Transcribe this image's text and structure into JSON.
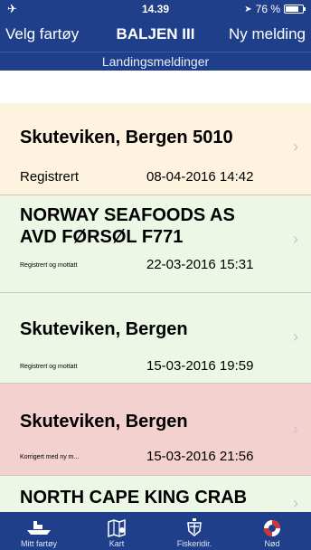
{
  "statusbar": {
    "time": "14.39",
    "battery": "76 %",
    "battery_level": 0.76
  },
  "navbar": {
    "left_button": "Velg fartøy",
    "title": "BALJEN III",
    "right_button": "Ny melding",
    "subtitle": "Landingsmeldinger"
  },
  "rows": [
    {
      "name": "Skuteviken, Bergen 5010",
      "status": "Registrert",
      "date": "08-04-2016 14:42",
      "color": "#fdf3df"
    },
    {
      "name": "NORWAY SEAFOODS AS\nAVD FØRSØL F771",
      "status": "Registrert og mottatt",
      "date": "22-03-2016 15:31",
      "color": "#ecf7e6"
    },
    {
      "name": "Skuteviken, Bergen",
      "status": "Registrert og mottatt",
      "date": "15-03-2016 19:59",
      "color": "#ecf7e6"
    },
    {
      "name": "Skuteviken, Bergen",
      "status": "Korrigert med ny m...",
      "date": "15-03-2016 21:56",
      "color": "#f2d1cf"
    },
    {
      "name": "NORTH CAPE KING CRAB",
      "status": "",
      "date": "",
      "color": "#ecf7e6"
    }
  ],
  "tabbar": {
    "tabs": [
      {
        "label": "Mitt fartøy",
        "icon": "boat-icon"
      },
      {
        "label": "Kart",
        "icon": "map-icon"
      },
      {
        "label": "Fiskeridir.",
        "icon": "emblem-icon"
      },
      {
        "label": "Nød",
        "icon": "lifebuoy-icon"
      }
    ]
  }
}
